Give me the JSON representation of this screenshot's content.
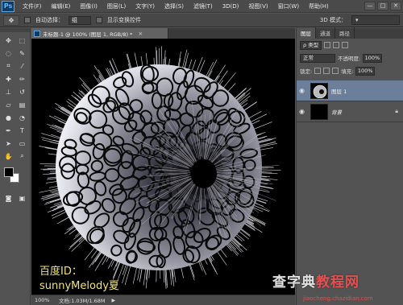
{
  "app": {
    "logo": "Ps"
  },
  "menu": [
    "文件(F)",
    "编辑(E)",
    "图像(I)",
    "图层(L)",
    "文字(Y)",
    "选择(S)",
    "滤镜(T)",
    "3D(D)",
    "视图(V)",
    "窗口(W)",
    "帮助(H)"
  ],
  "window_controls": [
    "—",
    "□",
    "✕"
  ],
  "options": {
    "auto_select_label": "自动选择：",
    "auto_select_value": "组",
    "show_transform_label": "显示变换控件",
    "mode_3d_label": "3D 模式："
  },
  "document": {
    "tab_title": "未标题-1 @ 100% (图层 1, RGB/8) *",
    "caption_line1": "百度ID：",
    "caption_line2": "sunnyMelody夏",
    "zoom": "100%",
    "doc_info": "文档:1.03M/1.68M"
  },
  "panels": {
    "tabs": [
      "图层",
      "通道",
      "路径"
    ],
    "filter_type": "ρ 类型",
    "blend_mode": "正常",
    "opacity_label": "不透明度:",
    "opacity_value": "100%",
    "lock_label": "锁定:",
    "fill_label": "填充:",
    "fill_value": "100%",
    "layers": [
      {
        "name": "图层 1",
        "selected": true
      },
      {
        "name": "背景",
        "selected": false
      }
    ]
  },
  "watermark": {
    "text_a": "查字典",
    "text_b": "教程网",
    "url": "jiaocheng.chazidian.com"
  },
  "colors": {
    "accent": "#6b7f9a",
    "caption": "#f2e27a",
    "watermark_red": "#e25050"
  }
}
